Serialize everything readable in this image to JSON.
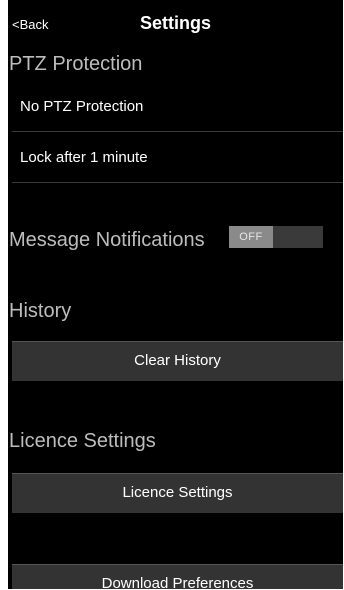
{
  "header": {
    "back_label": "<Back",
    "title": "Settings"
  },
  "ptz": {
    "heading": "PTZ Protection",
    "items": [
      {
        "label": "No PTZ Protection"
      },
      {
        "label": "Lock after 1 minute"
      }
    ]
  },
  "notifications": {
    "heading": "Message Notifications",
    "toggle_label": "OFF",
    "toggle_on": false
  },
  "history": {
    "heading": "History",
    "button_label": "Clear History"
  },
  "licence": {
    "heading": "Licence Settings",
    "button_label": "Licence Settings"
  },
  "download": {
    "button_label": "Download Preferences"
  },
  "colors": {
    "background": "#000000",
    "heading_text": "#bdbdbd",
    "button_bg": "#333333",
    "toggle_track": "#3a3a3a",
    "toggle_knob": "#8a8a8a"
  }
}
